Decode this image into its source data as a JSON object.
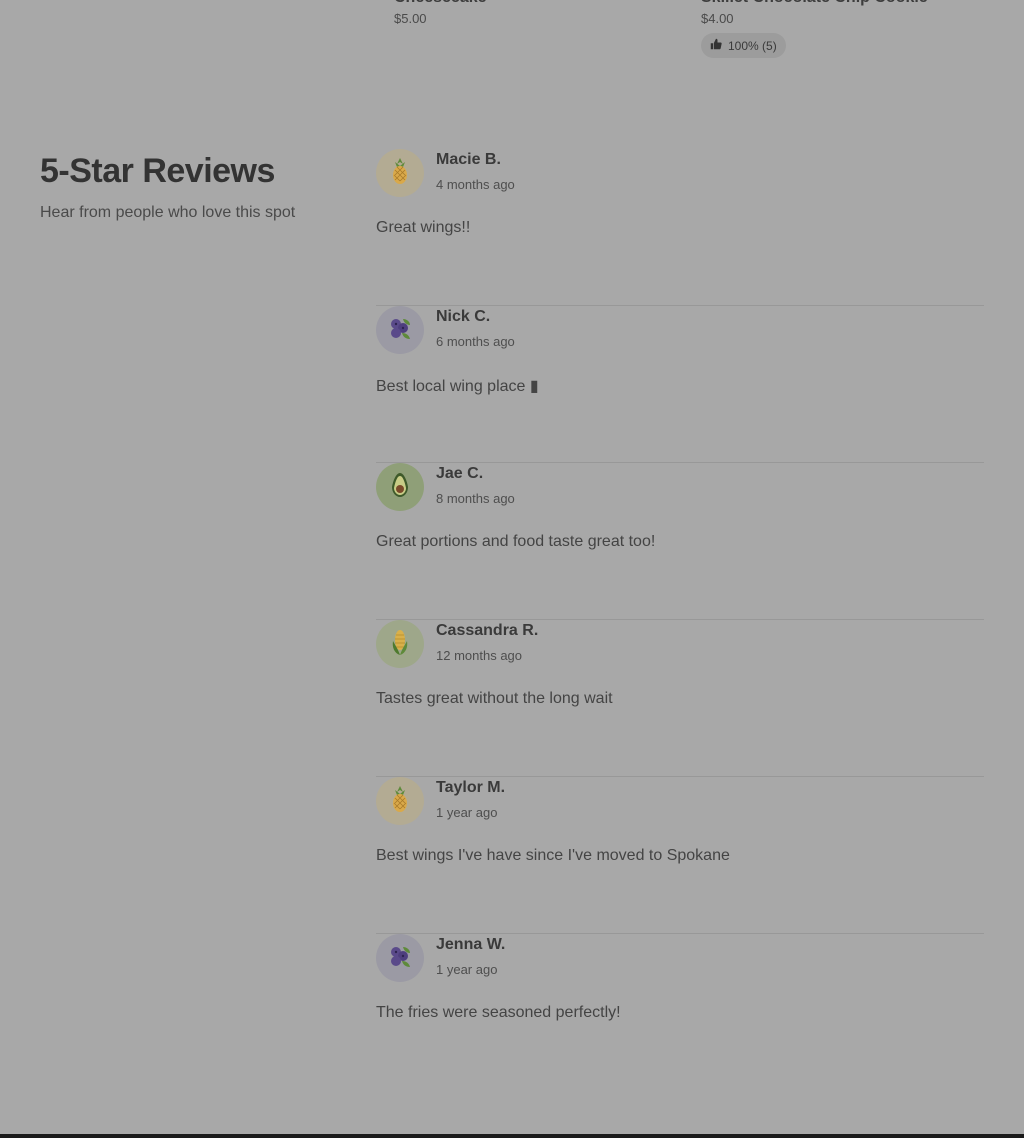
{
  "menu_items": [
    {
      "name": "Cheesecake",
      "price": "$5.00"
    },
    {
      "name": "Skillet Chocolate Chip Cookie",
      "price": "$4.00",
      "rating": "100% (5)"
    }
  ],
  "section": {
    "title": "5-Star Reviews",
    "subtitle": "Hear from people who love this spot"
  },
  "reviews": [
    {
      "name": "Macie B.",
      "time": "4 months ago",
      "text": "Great wings!!",
      "avatar_icon": "pineapple-icon",
      "avatar_bg": "#b3ab93"
    },
    {
      "name": "Nick C.",
      "time": "6 months ago",
      "text": "Best local wing place ▮",
      "avatar_icon": "blueberries-icon",
      "avatar_bg": "#9b9aa4"
    },
    {
      "name": "Jae C.",
      "time": "8 months ago",
      "text": "Great portions and food taste great too!",
      "avatar_icon": "avocado-icon",
      "avatar_bg": "#8f9f78"
    },
    {
      "name": "Cassandra R.",
      "time": "12 months ago",
      "text": "Tastes great without the long wait",
      "avatar_icon": "corn-icon",
      "avatar_bg": "#9ea78a"
    },
    {
      "name": "Taylor M.",
      "time": "1 year ago",
      "text": "Best wings I've have since I've moved to Spokane",
      "avatar_icon": "pineapple-icon",
      "avatar_bg": "#b3ab93"
    },
    {
      "name": "Jenna W.",
      "time": "1 year ago",
      "text": "The fries were seasoned perfectly!",
      "avatar_icon": "blueberries-icon",
      "avatar_bg": "#9b9aa4"
    }
  ]
}
